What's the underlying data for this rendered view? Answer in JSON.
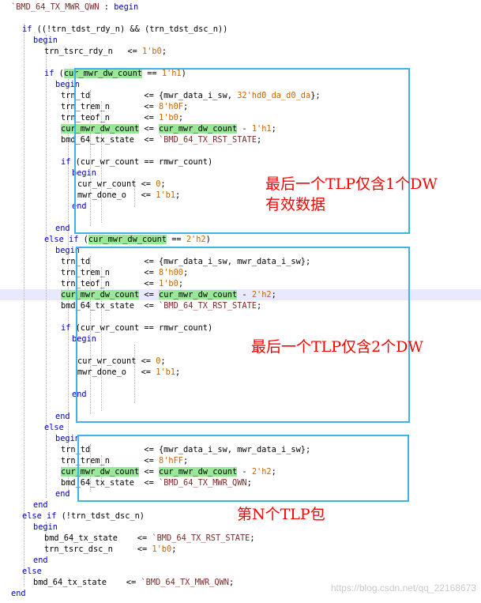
{
  "editor": {
    "highlighted_line_index": 26,
    "colors": {
      "background": "#ffffff",
      "keyword": "#0000c8",
      "number": "#c86400",
      "macro": "#7a2a2a",
      "variable_highlight": "#98e898",
      "annotation_box": "#3fb2e6",
      "annotation_text": "#ff0000"
    },
    "code": [
      {
        "indent": 0,
        "parts": [
          [
            "macro",
            "`BMD_64_TX_MWR_QWN"
          ],
          [
            "p",
            " : "
          ],
          [
            "kw",
            "begin"
          ]
        ]
      },
      {
        "indent": 0,
        "parts": []
      },
      {
        "indent": 4,
        "parts": [
          [
            "kw",
            "if"
          ],
          [
            "p",
            " ((!trn_tdst_rdy_n) && (trn_tdst_dsc_n))"
          ]
        ]
      },
      {
        "indent": 8,
        "parts": [
          [
            "kw",
            "begin"
          ]
        ]
      },
      {
        "indent": 12,
        "parts": [
          [
            "p",
            "trn_tsrc_rdy_n   <= "
          ],
          [
            "num",
            "1'b0"
          ],
          [
            "p",
            ";"
          ]
        ]
      },
      {
        "indent": 0,
        "parts": []
      },
      {
        "indent": 12,
        "parts": [
          [
            "kw",
            "if"
          ],
          [
            "p",
            " ("
          ],
          [
            "hl",
            "cur_mwr_dw_count"
          ],
          [
            "p",
            " == "
          ],
          [
            "num",
            "1'h1"
          ],
          [
            "p",
            ")"
          ]
        ]
      },
      {
        "indent": 16,
        "parts": [
          [
            "kw",
            "begin"
          ]
        ]
      },
      {
        "indent": 18,
        "parts": [
          [
            "p",
            "trn_td           <= {mwr_data_i_sw, "
          ],
          [
            "num",
            "32'hd0_da_d0_da"
          ],
          [
            "p",
            "};"
          ]
        ]
      },
      {
        "indent": 18,
        "parts": [
          [
            "p",
            "trn_trem_n       <= "
          ],
          [
            "num",
            "8'h0F"
          ],
          [
            "p",
            ";"
          ]
        ]
      },
      {
        "indent": 18,
        "parts": [
          [
            "p",
            "trn_teof_n       <= "
          ],
          [
            "num",
            "1'b0"
          ],
          [
            "p",
            ";"
          ]
        ]
      },
      {
        "indent": 18,
        "parts": [
          [
            "hl",
            "cur_mwr_dw_count"
          ],
          [
            "p",
            " <= "
          ],
          [
            "hl",
            "cur_mwr_dw_count"
          ],
          [
            "p",
            " - "
          ],
          [
            "num",
            "1'h1"
          ],
          [
            "p",
            ";"
          ]
        ]
      },
      {
        "indent": 18,
        "parts": [
          [
            "p",
            "bmd_64_tx_state  <= "
          ],
          [
            "macro",
            "`BMD_64_TX_RST_STATE"
          ],
          [
            "p",
            ";"
          ]
        ]
      },
      {
        "indent": 0,
        "parts": []
      },
      {
        "indent": 18,
        "parts": [
          [
            "kw",
            "if"
          ],
          [
            "p",
            " (cur_wr_count == rmwr_count)"
          ]
        ]
      },
      {
        "indent": 22,
        "parts": [
          [
            "kw",
            "begin"
          ]
        ]
      },
      {
        "indent": 24,
        "parts": [
          [
            "p",
            "cur_wr_count <= "
          ],
          [
            "num",
            "0"
          ],
          [
            "p",
            ";"
          ]
        ]
      },
      {
        "indent": 24,
        "parts": [
          [
            "p",
            "mwr_done_o   <= "
          ],
          [
            "num",
            "1'b1"
          ],
          [
            "p",
            ";"
          ]
        ]
      },
      {
        "indent": 22,
        "parts": [
          [
            "kw",
            "end"
          ]
        ]
      },
      {
        "indent": 0,
        "parts": []
      },
      {
        "indent": 16,
        "parts": [
          [
            "kw",
            "end"
          ]
        ]
      },
      {
        "indent": 12,
        "parts": [
          [
            "kw",
            "else if"
          ],
          [
            "p",
            " ("
          ],
          [
            "hl",
            "cur_mwr_dw_count"
          ],
          [
            "p",
            " == "
          ],
          [
            "num",
            "2'h2"
          ],
          [
            "p",
            ")"
          ]
        ]
      },
      {
        "indent": 16,
        "parts": [
          [
            "kw",
            "begin"
          ]
        ]
      },
      {
        "indent": 18,
        "parts": [
          [
            "p",
            "trn_td           <= {mwr_data_i_sw, mwr_data_i_sw};"
          ]
        ]
      },
      {
        "indent": 18,
        "parts": [
          [
            "p",
            "trn_trem_n       <= "
          ],
          [
            "num",
            "8'h00"
          ],
          [
            "p",
            ";"
          ]
        ]
      },
      {
        "indent": 18,
        "parts": [
          [
            "p",
            "trn_teof_n       <= "
          ],
          [
            "num",
            "1'b0"
          ],
          [
            "p",
            ";"
          ]
        ]
      },
      {
        "indent": 18,
        "parts": [
          [
            "hl",
            "cur_mwr_dw_count"
          ],
          [
            "p",
            " <= "
          ],
          [
            "hl",
            "cur_mwr_dw_count"
          ],
          [
            "p",
            " - "
          ],
          [
            "num",
            "2'h2"
          ],
          [
            "p",
            ";"
          ]
        ]
      },
      {
        "indent": 18,
        "parts": [
          [
            "p",
            "bmd_64_tx_state  <= "
          ],
          [
            "macro",
            "`BMD_64_TX_RST_STATE"
          ],
          [
            "p",
            ";"
          ]
        ]
      },
      {
        "indent": 0,
        "parts": []
      },
      {
        "indent": 18,
        "parts": [
          [
            "kw",
            "if"
          ],
          [
            "p",
            " (cur_wr_count == rmwr_count)"
          ]
        ]
      },
      {
        "indent": 22,
        "parts": [
          [
            "kw",
            "begin"
          ]
        ]
      },
      {
        "indent": 0,
        "parts": []
      },
      {
        "indent": 24,
        "parts": [
          [
            "p",
            "cur_wr_count <= "
          ],
          [
            "num",
            "0"
          ],
          [
            "p",
            ";"
          ]
        ]
      },
      {
        "indent": 24,
        "parts": [
          [
            "p",
            "mwr_done_o   <= "
          ],
          [
            "num",
            "1'b1"
          ],
          [
            "p",
            ";"
          ]
        ]
      },
      {
        "indent": 0,
        "parts": []
      },
      {
        "indent": 22,
        "parts": [
          [
            "kw",
            "end"
          ]
        ]
      },
      {
        "indent": 0,
        "parts": []
      },
      {
        "indent": 16,
        "parts": [
          [
            "kw",
            "end"
          ]
        ]
      },
      {
        "indent": 12,
        "parts": [
          [
            "kw",
            "else"
          ]
        ]
      },
      {
        "indent": 16,
        "parts": [
          [
            "kw",
            "begin"
          ]
        ]
      },
      {
        "indent": 18,
        "parts": [
          [
            "p",
            "trn_td           <= {mwr_data_i_sw, mwr_data_i_sw};"
          ]
        ]
      },
      {
        "indent": 18,
        "parts": [
          [
            "p",
            "trn_trem_n       <= "
          ],
          [
            "num",
            "8'hFF"
          ],
          [
            "p",
            ";"
          ]
        ]
      },
      {
        "indent": 18,
        "parts": [
          [
            "hl",
            "cur_mwr_dw_count"
          ],
          [
            "p",
            " <= "
          ],
          [
            "hl",
            "cur_mwr_dw_count"
          ],
          [
            "p",
            " - "
          ],
          [
            "num",
            "2'h2"
          ],
          [
            "p",
            ";"
          ]
        ]
      },
      {
        "indent": 18,
        "parts": [
          [
            "p",
            "bmd_64_tx_state  <= "
          ],
          [
            "macro",
            "`BMD_64_TX_MWR_QWN"
          ],
          [
            "p",
            ";"
          ]
        ]
      },
      {
        "indent": 16,
        "parts": [
          [
            "kw",
            "end"
          ]
        ]
      },
      {
        "indent": 8,
        "parts": [
          [
            "kw",
            "end"
          ]
        ]
      },
      {
        "indent": 4,
        "parts": [
          [
            "kw",
            "else if"
          ],
          [
            "p",
            " (!trn_tdst_dsc_n)"
          ]
        ]
      },
      {
        "indent": 8,
        "parts": [
          [
            "kw",
            "begin"
          ]
        ]
      },
      {
        "indent": 12,
        "parts": [
          [
            "p",
            "bmd_64_tx_state    <= "
          ],
          [
            "macro",
            "`BMD_64_TX_RST_STATE"
          ],
          [
            "p",
            ";"
          ]
        ]
      },
      {
        "indent": 12,
        "parts": [
          [
            "p",
            "trn_tsrc_dsc_n     <= "
          ],
          [
            "num",
            "1'b0"
          ],
          [
            "p",
            ";"
          ]
        ]
      },
      {
        "indent": 8,
        "parts": [
          [
            "kw",
            "end"
          ]
        ]
      },
      {
        "indent": 4,
        "parts": [
          [
            "kw",
            "else"
          ]
        ]
      },
      {
        "indent": 8,
        "parts": [
          [
            "p",
            "bmd_64_tx_state    <= "
          ],
          [
            "macro",
            "`BMD_64_TX_MWR_QWN"
          ],
          [
            "p",
            ";"
          ]
        ]
      },
      {
        "indent": 0,
        "parts": [
          [
            "kw",
            "end"
          ]
        ]
      }
    ]
  },
  "annotations": {
    "note1": "最后一个TLP仅含1个DW\n有效数据",
    "note2": "最后一个TLP仅含2个DW",
    "note3": "第N个TLP包"
  },
  "watermark": "https://blog.csdn.net/qq_22168673"
}
